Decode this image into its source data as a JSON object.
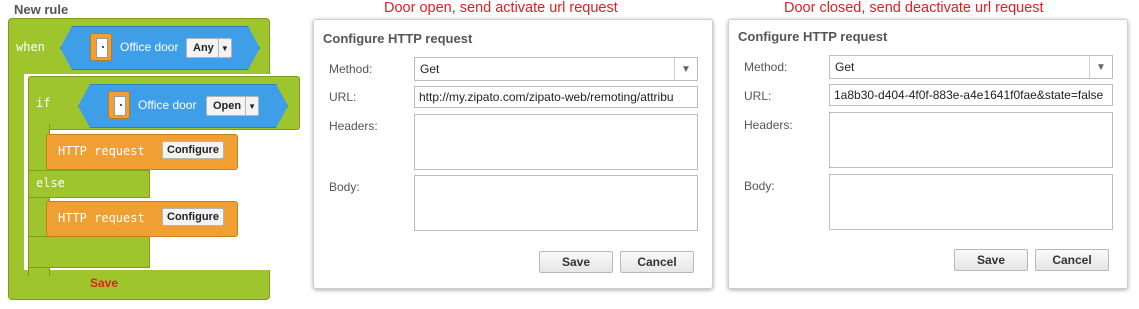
{
  "rule": {
    "title": "New rule",
    "when_label": "when",
    "if_label": "if",
    "else_label": "else",
    "save_label": "Save",
    "when_device": {
      "name": "Office door",
      "icon": "door-icon",
      "state": "Any"
    },
    "if_device": {
      "name": "Office door",
      "icon": "door-icon",
      "state": "Open"
    },
    "actions": [
      {
        "label": "HTTP request",
        "button": "Configure"
      },
      {
        "label": "HTTP request",
        "button": "Configure"
      }
    ]
  },
  "captions": {
    "open": "Door open, send activate url request",
    "closed": "Door closed, send deactivate url request"
  },
  "dialogs": [
    {
      "title": "Configure HTTP request",
      "method_label": "Method:",
      "method_value": "Get",
      "url_label": "URL:",
      "url_value": "http://my.zipato.com/zipato-web/remoting/attribu",
      "headers_label": "Headers:",
      "headers_value": "",
      "body_label": "Body:",
      "body_value": "",
      "save": "Save",
      "cancel": "Cancel"
    },
    {
      "title": "Configure HTTP request",
      "method_label": "Method:",
      "method_value": "Get",
      "url_label": "URL:",
      "url_value": "1a8b30-d404-4f0f-883e-a4e1641f0fae&state=false",
      "headers_label": "Headers:",
      "headers_value": "",
      "body_label": "Body:",
      "body_value": "",
      "save": "Save",
      "cancel": "Cancel"
    }
  ],
  "colors": {
    "block_green": "#9fc52d",
    "block_blue": "#3f9ee8",
    "block_orange": "#f0a033",
    "caption_red": "#e02020"
  }
}
